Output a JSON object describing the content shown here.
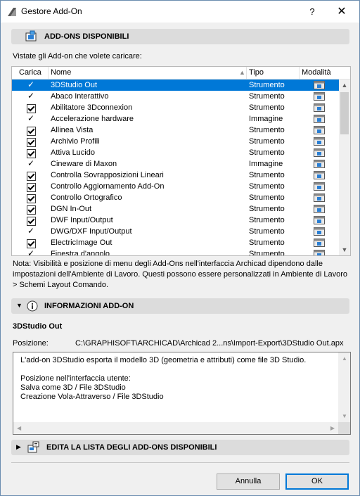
{
  "window": {
    "title": "Gestore Add-On",
    "help_label": "?",
    "close_label": "✕"
  },
  "available": {
    "section_title": "ADD-ONS DISPONIBILI",
    "intro": "Vistate gli Add-on che volete caricare:",
    "columns": {
      "load": "Carica",
      "name": "Nome",
      "type": "Tipo",
      "mode": "Modalità"
    },
    "rows": [
      {
        "name": "3DStudio Out",
        "type": "Strumento",
        "load": "tick",
        "selected": true
      },
      {
        "name": "Abaco Interattivo",
        "type": "Strumento",
        "load": "tick"
      },
      {
        "name": "Abilitatore 3Dconnexion",
        "type": "Strumento",
        "load": "checkbox"
      },
      {
        "name": "Accelerazione hardware",
        "type": "Immagine",
        "load": "tick"
      },
      {
        "name": "Allinea Vista",
        "type": "Strumento",
        "load": "checkbox"
      },
      {
        "name": "Archivio Profili",
        "type": "Strumento",
        "load": "checkbox"
      },
      {
        "name": "Attiva Lucido",
        "type": "Strumento",
        "load": "checkbox"
      },
      {
        "name": "Cineware di Maxon",
        "type": "Immagine",
        "load": "tick"
      },
      {
        "name": "Controlla Sovrapposizioni Lineari",
        "type": "Strumento",
        "load": "checkbox"
      },
      {
        "name": "Controllo Aggiornamento Add-On",
        "type": "Strumento",
        "load": "checkbox"
      },
      {
        "name": "Controllo Ortografico",
        "type": "Strumento",
        "load": "checkbox"
      },
      {
        "name": "DGN In-Out",
        "type": "Strumento",
        "load": "checkbox"
      },
      {
        "name": "DWF Input/Output",
        "type": "Strumento",
        "load": "checkbox"
      },
      {
        "name": "DWG/DXF Input/Output",
        "type": "Strumento",
        "load": "tick"
      },
      {
        "name": "ElectricImage Out",
        "type": "Strumento",
        "load": "checkbox"
      },
      {
        "name": "Finestra d'angolo",
        "type": "Strumento",
        "load": "tick"
      }
    ],
    "note": "Nota: Visibilità e posizione di menu degli Add-Ons nell'interfaccia Archicad dipendono dalle impostazioni dell'Ambiente di Lavoro. Questi possono essere personalizzati in Ambiente di Lavoro > Schemi Layout Comando."
  },
  "info": {
    "section_title": "INFORMAZIONI ADD-ON",
    "addon_name": "3DStudio Out",
    "position_label": "Posizione:",
    "position_value": "C:\\GRAPHISOFT\\ARCHICAD\\Archicad 2...ns\\Import-Export\\3DStudio Out.apx",
    "description": "L'add-on 3DStudio esporta il modello 3D (geometria e attributi) come file 3D Studio.\n\nPosizione nell'interfaccia utente:\nSalva come 3D / File 3DStudio\nCreazione Vola-Attraverso / File 3DStudio"
  },
  "edit": {
    "section_title": "EDITA LA LISTA DEGLI ADD-ONS DISPONIBILI"
  },
  "buttons": {
    "cancel": "Annulla",
    "ok": "OK"
  },
  "colors": {
    "selection": "#0078d7",
    "section_bg": "#dcdcdc"
  }
}
